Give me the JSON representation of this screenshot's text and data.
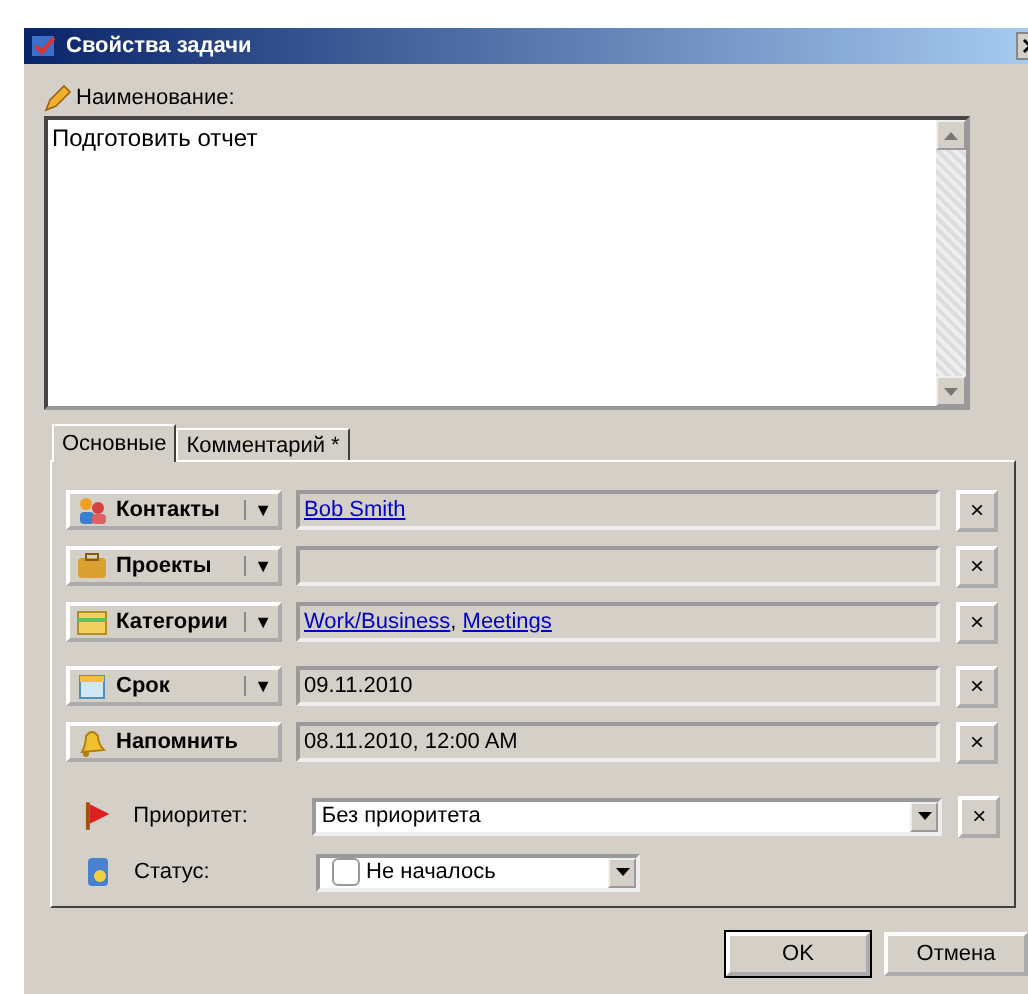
{
  "window": {
    "title": "Свойства задачи"
  },
  "name_field": {
    "label": "Наименование:",
    "value": "Подготовить отчет"
  },
  "tabs": [
    {
      "label": "Основные",
      "selected": true
    },
    {
      "label": "Комментарий *",
      "selected": false
    }
  ],
  "rows": [
    {
      "kind": "dropdown_button",
      "label": "Контакты",
      "arrow": "▼",
      "parts": [
        {
          "text": "Bob Smith",
          "link": true
        }
      ],
      "clear": "×"
    },
    {
      "kind": "dropdown_button",
      "label": "Проекты",
      "arrow": "▼",
      "parts": [],
      "clear": "×"
    },
    {
      "kind": "dropdown_button",
      "label": "Категории",
      "arrow": "▼",
      "parts": [
        {
          "text": "Work/Business",
          "link": true
        },
        {
          "text": ", ",
          "link": false
        },
        {
          "text": "Meetings",
          "link": true
        }
      ],
      "clear": "×"
    },
    {
      "kind": "dropdown_button",
      "label": "Срок",
      "arrow": "▼",
      "parts": [
        {
          "text": "09.11.2010",
          "link": false
        }
      ],
      "clear": "×"
    },
    {
      "kind": "button",
      "label": "Напомнить",
      "parts": [
        {
          "text": "08.11.2010, 12:00 AM",
          "link": false
        }
      ],
      "clear": "×"
    }
  ],
  "priority": {
    "label": "Приоритет:",
    "value": "Без приоритета",
    "clear": "×"
  },
  "status": {
    "label": "Статус:",
    "value": "Не началось",
    "checked": false
  },
  "buttons": [
    "OK",
    "Отмена"
  ]
}
